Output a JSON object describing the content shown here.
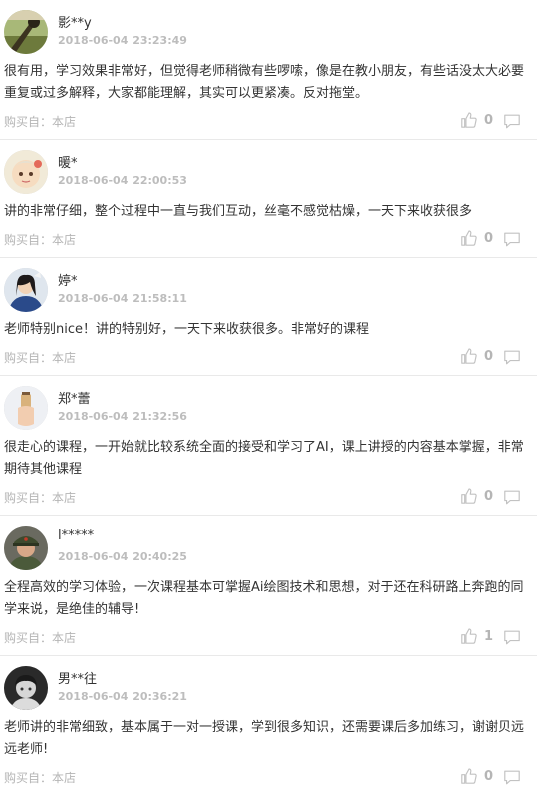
{
  "source_label": "购买自：本店",
  "reviews": [
    {
      "name": "影**y",
      "time": "2018-06-04 23:23:49",
      "text": "很有用，学习效果非常好，但觉得老师稍微有些啰嗦，像是在教小朋友，有些话没太大必要重复或过多解释，大家都能理解，其实可以更紧凑。反对拖堂。",
      "likes": "0",
      "avatar": "avatar-landscape"
    },
    {
      "name": "暖*",
      "time": "2018-06-04 22:00:53",
      "text": "讲的非常仔细，整个过程中一直与我们互动，丝毫不感觉枯燥，一天下来收获很多",
      "likes": "0",
      "avatar": "avatar-character"
    },
    {
      "name": "婷*",
      "time": "2018-06-04 21:58:11",
      "text": "老师特别nice！讲的特别好，一天下来收获很多。非常好的课程",
      "likes": "0",
      "avatar": "avatar-person-blue"
    },
    {
      "name": "郑*蕾",
      "time": "2018-06-04 21:32:56",
      "text": "很走心的课程，一开始就比较系统全面的接受和学习了AI，课上讲授的内容基本掌握，非常期待其他课程",
      "likes": "0",
      "avatar": "avatar-hand-drink"
    },
    {
      "name": "l*****",
      "time": "2018-06-04 20:40:25",
      "text": "全程高效的学习体验，一次课程基本可掌握Ai绘图技术和思想，对于还在科研路上奔跑的同学来说，是绝佳的辅导!",
      "likes": "1",
      "avatar": "avatar-soldier"
    },
    {
      "name": "男**往",
      "time": "2018-06-04 20:36:21",
      "text": "老师讲的非常细致，基本属于一对一授课，学到很多知识，还需要课后多加练习，谢谢贝远远老师!",
      "likes": "0",
      "avatar": "avatar-child-bw"
    }
  ]
}
